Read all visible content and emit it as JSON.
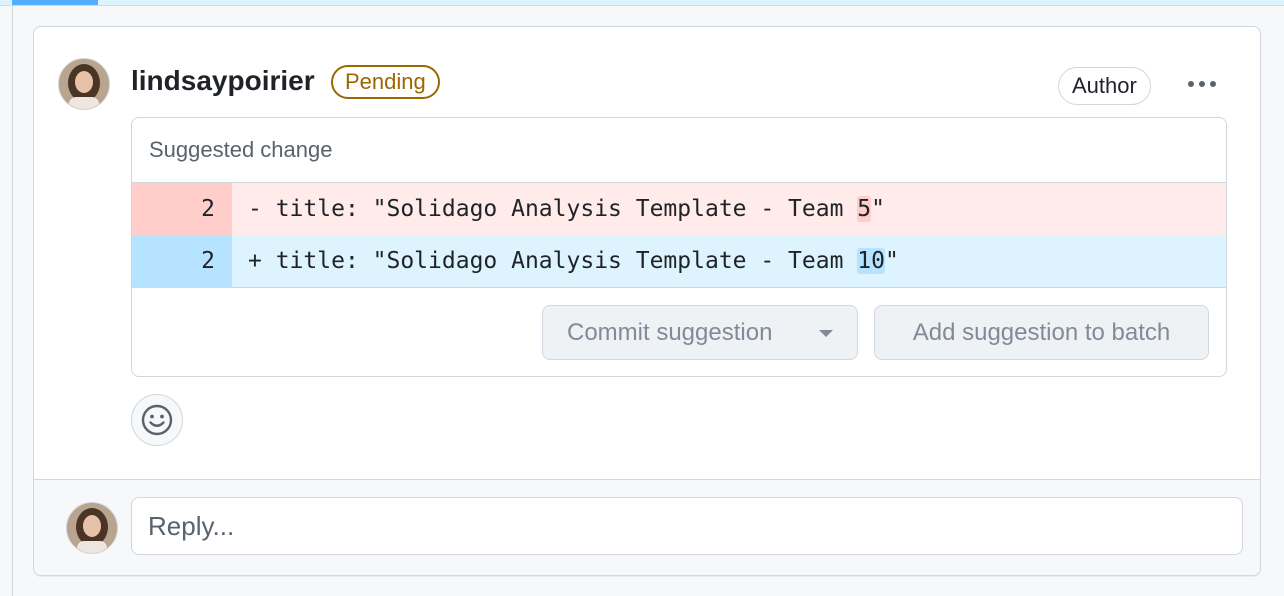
{
  "comment": {
    "username": "lindsaypoirier",
    "status_badge": "Pending",
    "role_badge": "Author"
  },
  "suggestion": {
    "header": "Suggested change",
    "removed": {
      "line_number": "2",
      "prefix": "- ",
      "code_before": "title: \"Solidago Analysis Template - Team ",
      "highlight": "5",
      "code_after": "\""
    },
    "added": {
      "line_number": "2",
      "prefix": "+ ",
      "code_before": "title: \"Solidago Analysis Template - Team ",
      "highlight": "10",
      "code_after": "\""
    },
    "commit_label": "Commit suggestion",
    "batch_label": "Add suggestion to batch"
  },
  "reply": {
    "placeholder": "Reply..."
  },
  "colors": {
    "pending": "#9a6700",
    "deletion_bg": "#ffebe9",
    "addition_bg": "#ddf4ff",
    "accent": "#54aeff"
  }
}
